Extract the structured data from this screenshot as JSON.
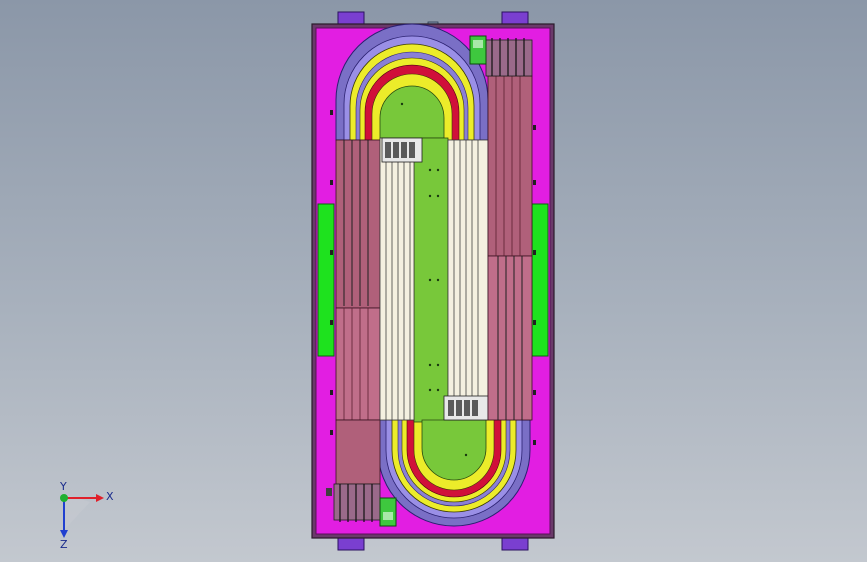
{
  "triad": {
    "x_label": "X",
    "y_label": "Y",
    "z_label": "Z"
  },
  "colors": {
    "background_top": "#8b97a8",
    "frame_magenta": "#e21ee2",
    "frame_outline": "#6a0f6a",
    "belt_lavender": "#8a7fd6",
    "belt_yellow": "#ecec2a",
    "belt_red": "#d0103a",
    "inner_green": "#78c83a",
    "side_green": "#1ee21e",
    "rail_mauve": "#b0607a",
    "rail_light": "#f4f0e0",
    "triad_x": "#e0202a",
    "triad_y": "#20b030",
    "triad_z": "#2040d0"
  },
  "icons": [
    "coordinate-triad-icon"
  ]
}
